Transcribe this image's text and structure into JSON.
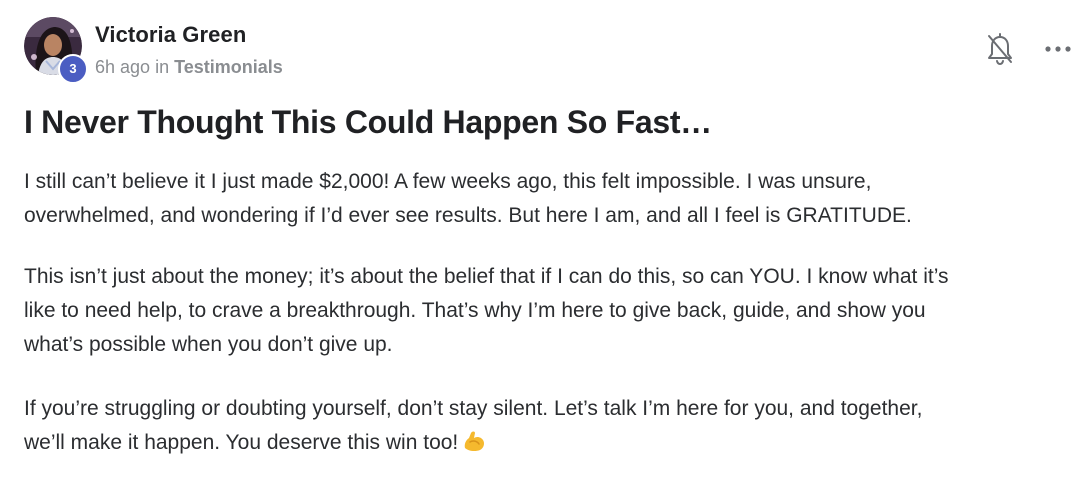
{
  "post": {
    "author": {
      "name": "Victoria Green",
      "level": "3",
      "avatar_icon": "user-avatar"
    },
    "meta": {
      "time": "6h ago",
      "in_word": "in",
      "category": "Testimonials"
    },
    "actions": {
      "notifications_icon": "bell-off-icon",
      "more_icon": "more-horizontal-icon"
    },
    "title": "I Never Thought This Could Happen So Fast…",
    "body": {
      "p1_line1": "I still can’t believe it I just made $2,000! A few weeks ago, this felt impossible. I was unsure,",
      "p1_line2": "overwhelmed, and wondering if I’d ever see results. But here I am, and all I feel is GRATITUDE.",
      "p2_line1": "This isn’t just about the money; it’s about the belief that if I can do this, so can YOU. I know what it’s",
      "p2_line2": "like to need help, to crave a breakthrough. That’s why I’m here to give back, guide, and show you",
      "p2_line3": "what’s possible when you don’t give up.",
      "p3_line1": "If you’re struggling or doubting yourself, don’t stay silent. Let’s talk I’m here for you, and together,",
      "p3_line2": "we’ll make it happen. You deserve this win too!",
      "emoji_icon": "flexed-biceps-icon"
    },
    "colors": {
      "badge": "#4b5dc2",
      "meta_text": "#8a8d91",
      "emoji": "#f5b92e"
    }
  }
}
